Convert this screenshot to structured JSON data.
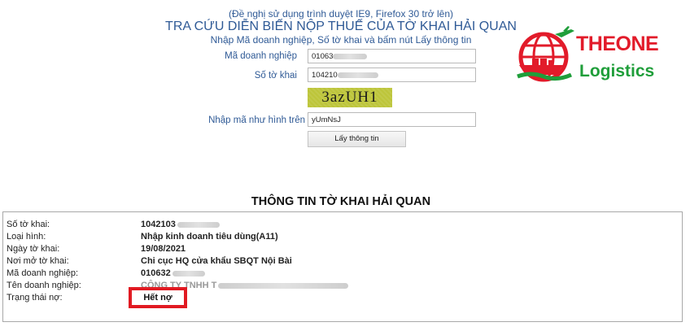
{
  "header": {
    "note": "(Đề nghị sử dụng trình duyệt IE9, Firefox 30 trở lên)",
    "title": "TRA CỨU DIỄN BIẾN NỘP THUẾ CỦA TỜ KHAI HẢI QUAN",
    "subtitle": "Nhập Mã doanh nghiệp, Số tờ khai và bấm nút Lấy thông tin"
  },
  "form": {
    "company_code_label": "Mã doanh nghiệp",
    "company_code_value": "01063",
    "declaration_no_label": "Số tờ khai",
    "declaration_no_value": "104210",
    "captcha_text": "3azUH1",
    "captcha_label": "Nhập mã như hình trên",
    "captcha_value": "yUmNsJ",
    "submit_label": "Lấy thông tin"
  },
  "logo": {
    "line1": "THEONE",
    "line2": "Logistics"
  },
  "info": {
    "title": "THÔNG TIN TỜ KHAI HẢI QUAN",
    "rows": [
      {
        "label": "Số tờ khai:",
        "value": "1042103"
      },
      {
        "label": "Loại hình:",
        "value": "Nhập kinh doanh tiêu dùng(A11)"
      },
      {
        "label": "Ngày tờ khai:",
        "value": "19/08/2021"
      },
      {
        "label": "Nơi mở tờ khai:",
        "value": "Chi cục HQ cửa khẩu SBQT Nội Bài"
      },
      {
        "label": "Mã doanh nghiệp:",
        "value": "010632"
      },
      {
        "label": "Tên doanh nghiệp:",
        "value": "CÔNG TY TNHH T"
      },
      {
        "label": "Trạng thái nợ:",
        "value": "Hết nợ"
      }
    ]
  },
  "colors": {
    "heading_blue": "#2f5a96",
    "highlight_red": "#e11a22",
    "captcha_bg": "#bdc53a",
    "logo_red": "#e21b2a",
    "logo_green": "#1f9e3a"
  }
}
